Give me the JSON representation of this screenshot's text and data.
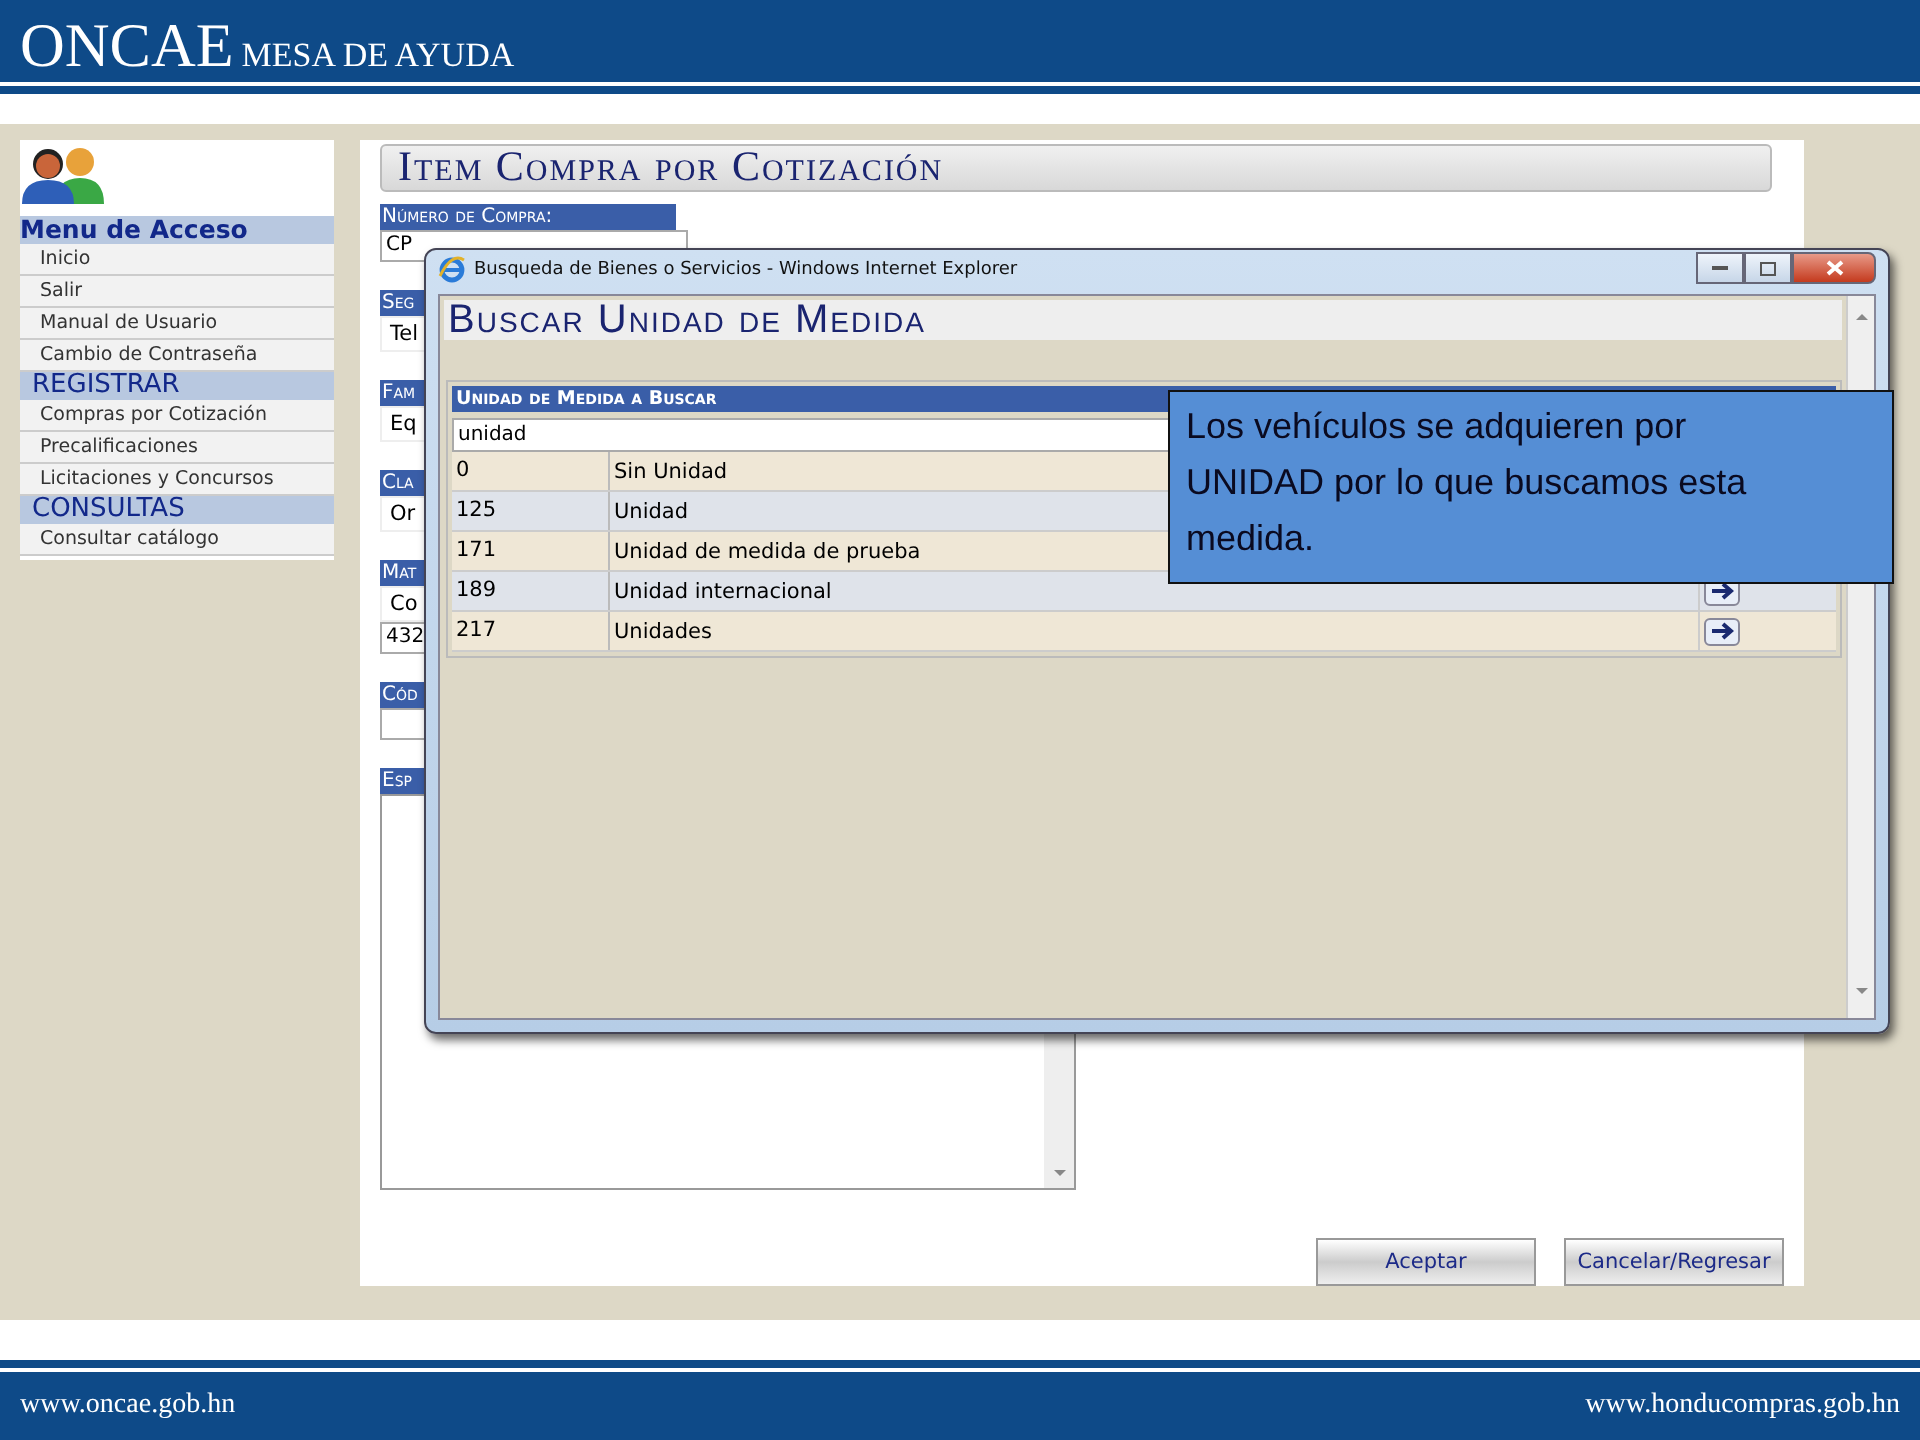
{
  "header": {
    "logo": "ONCAE",
    "subtitle": "MESA DE AYUDA"
  },
  "sidebar": {
    "sections": [
      {
        "title": "Menu de Acceso",
        "kind": "bold",
        "items": [
          "Inicio",
          "Salir",
          "Manual de Usuario",
          "Cambio de Contraseña"
        ]
      },
      {
        "title": "REGISTRAR",
        "kind": "plain",
        "items": [
          "Compras por Cotización",
          "Precalificaciones",
          "Licitaciones y Concursos"
        ]
      },
      {
        "title": "CONSULTAS",
        "kind": "plain",
        "items": [
          "Consultar catálogo"
        ]
      }
    ]
  },
  "page": {
    "title": "Item Compra por Cotización",
    "fields": [
      {
        "label": "Número de Compra:",
        "kind": "input",
        "values": [
          "CP"
        ]
      },
      {
        "label": "Seg",
        "kind": "text",
        "values": [
          "Tel"
        ]
      },
      {
        "label": "Fam",
        "kind": "text",
        "values": [
          "Eq"
        ]
      },
      {
        "label": "Cla",
        "kind": "text",
        "values": [
          "Or"
        ]
      },
      {
        "label": "Mat",
        "kind": "text",
        "values": [
          "Co",
          "432"
        ]
      },
      {
        "label": "Cód",
        "kind": "empty"
      },
      {
        "label": "Esp",
        "kind": "textarea"
      }
    ],
    "buttons": [
      "Aceptar",
      "Cancelar/Regresar"
    ]
  },
  "popup": {
    "title": "Busqueda de Bienes o Servicios - Windows Internet Explorer",
    "heading": "Buscar Unidad de Medida",
    "search_label": "Unidad de Medida a Buscar",
    "search_value": "unidad",
    "results": [
      {
        "code": "0",
        "name": "Sin Unidad",
        "arrow": false
      },
      {
        "code": "125",
        "name": "Unidad",
        "arrow": false
      },
      {
        "code": "171",
        "name": "Unidad de medida de prueba",
        "arrow": false
      },
      {
        "code": "189",
        "name": "Unidad internacional",
        "arrow": true
      },
      {
        "code": "217",
        "name": "Unidades",
        "arrow": true
      }
    ]
  },
  "callout": {
    "text": "Los vehículos se adquieren por UNIDAD por lo que buscamos esta medida."
  },
  "footer": {
    "left": "www.oncae.gob.hn",
    "right": "www.honducompras.gob.hn"
  }
}
